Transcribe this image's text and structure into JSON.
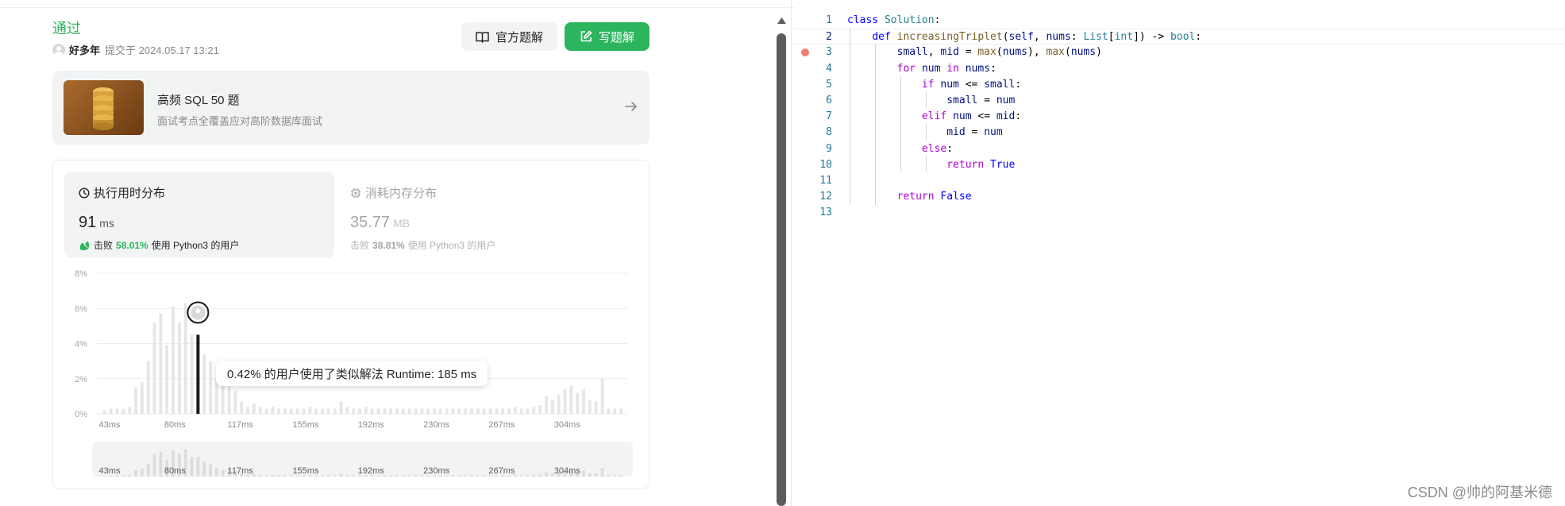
{
  "submission": {
    "status": "通过",
    "user": "好多年",
    "submitted_at": "提交于 2024.05.17 13:21"
  },
  "toolbar": {
    "official_label": "官方题解",
    "write_label": "写题解"
  },
  "promo": {
    "title": "高频 SQL 50 题",
    "subtitle": "面试考点全覆盖应对高阶数据库面试"
  },
  "runtime": {
    "tab_label": "执行用时分布",
    "value": "91",
    "unit": "ms",
    "beats_prefix": "击败",
    "beats_pct": "58.01%",
    "beats_suffix": "使用 Python3 的用户"
  },
  "memory": {
    "tab_label": "消耗内存分布",
    "value": "35.77",
    "unit": "MB",
    "beats_prefix": "击败",
    "beats_pct": "38.81%",
    "beats_suffix": "使用 Python3 的用户"
  },
  "tooltip": {
    "text": "0.42% 的用户使用了类似解法 Runtime: 185 ms"
  },
  "chart_data": {
    "type": "bar",
    "y_ticks": [
      "8%",
      "6%",
      "4%",
      "2%",
      "0%"
    ],
    "ylim": [
      0,
      8
    ],
    "x_ticks": [
      "43ms",
      "80ms",
      "117ms",
      "155ms",
      "192ms",
      "230ms",
      "267ms",
      "304ms"
    ],
    "values": [
      0.2,
      0.3,
      0.3,
      0.3,
      0.4,
      1.5,
      1.8,
      3.0,
      5.2,
      5.7,
      3.9,
      6.1,
      5.2,
      6.3,
      4.5,
      4.5,
      3.4,
      3.0,
      2.0,
      1.6,
      1.7,
      1.3,
      0.7,
      0.4,
      0.6,
      0.4,
      0.3,
      0.4,
      0.3,
      0.3,
      0.3,
      0.3,
      0.3,
      0.4,
      0.3,
      0.3,
      0.3,
      0.3,
      0.7,
      0.4,
      0.3,
      0.3,
      0.4,
      0.3,
      0.3,
      0.3,
      0.3,
      0.3,
      0.3,
      0.3,
      0.3,
      0.3,
      0.3,
      0.3,
      0.3,
      0.3,
      0.3,
      0.3,
      0.3,
      0.3,
      0.3,
      0.3,
      0.3,
      0.3,
      0.3,
      0.3,
      0.4,
      0.3,
      0.3,
      0.4,
      0.5,
      1.0,
      0.8,
      1.1,
      1.4,
      1.6,
      1.2,
      1.4,
      0.8,
      0.7,
      2.0,
      0.3,
      0.3,
      0.3
    ],
    "highlight_index": 15,
    "highlight_value": 4.5
  },
  "editor": {
    "lines": [
      {
        "n": "1",
        "html": "<span class=\"kw\">class</span> <span class=\"cls\">Solution</span>:"
      },
      {
        "n": "2",
        "html": "    <span class=\"kw\">def</span> <span class=\"fn\">increasingTriplet</span>(<span class=\"var\">self</span>, <span class=\"var\">nums</span>: <span class=\"cls\">List</span>[<span class=\"cls\">int</span>]) -> <span class=\"cls\">bool</span>:"
      },
      {
        "n": "3",
        "html": "        <span class=\"var\">small</span>, <span class=\"var\">mid</span> = <span class=\"fn\">max</span>(<span class=\"var\">nums</span>), <span class=\"fn\">max</span>(<span class=\"var\">nums</span>)"
      },
      {
        "n": "4",
        "html": "        <span class=\"kw2\">for</span> <span class=\"var\">num</span> <span class=\"kw2\">in</span> <span class=\"var\">nums</span>:"
      },
      {
        "n": "5",
        "html": "            <span class=\"kw2\">if</span> <span class=\"var\">num</span> <= <span class=\"var\">small</span>:"
      },
      {
        "n": "6",
        "html": "                <span class=\"var\">small</span> = <span class=\"var\">num</span>"
      },
      {
        "n": "7",
        "html": "            <span class=\"kw2\">elif</span> <span class=\"var\">num</span> <= <span class=\"var\">mid</span>:"
      },
      {
        "n": "8",
        "html": "                <span class=\"var\">mid</span> = <span class=\"var\">num</span>"
      },
      {
        "n": "9",
        "html": "            <span class=\"kw2\">else</span>:"
      },
      {
        "n": "10",
        "html": "                <span class=\"kw2\">return</span> <span class=\"kw\">True</span>"
      },
      {
        "n": "11",
        "html": ""
      },
      {
        "n": "12",
        "html": "        <span class=\"kw2\">return</span> <span class=\"kw\">False</span>"
      },
      {
        "n": "13",
        "html": ""
      }
    ]
  },
  "watermark": "CSDN @帅的阿基米德",
  "colors": {
    "accent": "#2db55d",
    "bar": "#e6e6e6",
    "highlight": "#1a1a1a",
    "breakpoint": "#e51400"
  }
}
